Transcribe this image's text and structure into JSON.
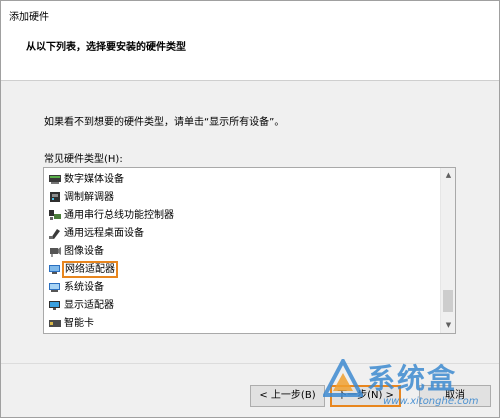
{
  "window": {
    "title": "添加硬件"
  },
  "header": {
    "subtitle": "从以下列表，选择要安装的硬件类型"
  },
  "info_text": "如果看不到想要的硬件类型，请单击“显示所有设备”。",
  "list": {
    "label": "常见硬件类型(H):",
    "items": [
      {
        "label": "数字媒体设备",
        "icon": "media-device-icon"
      },
      {
        "label": "调制解调器",
        "icon": "modem-icon"
      },
      {
        "label": "通用串行总线功能控制器",
        "icon": "usb-controller-icon"
      },
      {
        "label": "通用远程桌面设备",
        "icon": "remote-desktop-icon"
      },
      {
        "label": "图像设备",
        "icon": "camera-icon"
      },
      {
        "label": "网络适配器",
        "icon": "network-adapter-icon",
        "selected": true
      },
      {
        "label": "系统设备",
        "icon": "system-device-icon"
      },
      {
        "label": "显示适配器",
        "icon": "display-adapter-icon"
      },
      {
        "label": "智能卡",
        "icon": "smart-card-icon"
      }
    ]
  },
  "buttons": {
    "back": "< 上一步(B)",
    "next": "下一步(N) >",
    "cancel": "取消"
  },
  "watermark": {
    "text": "系统盒",
    "url": "www.xitonghe.com"
  },
  "colors": {
    "highlight": "#e8861e",
    "watermark": "#3d8ad0"
  }
}
